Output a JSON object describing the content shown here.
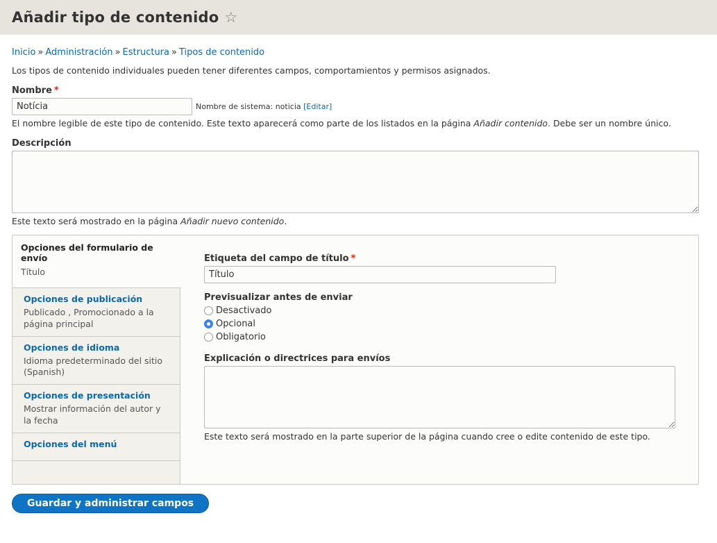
{
  "header": {
    "title": "Añadir tipo de contenido",
    "star": "☆"
  },
  "breadcrumb": {
    "items": [
      "Inicio",
      "Administración",
      "Estructura",
      "Tipos de contenido"
    ],
    "separator": "»"
  },
  "intro": "Los tipos de contenido individuales pueden tener diferentes campos, comportamientos y permisos asignados.",
  "name_field": {
    "label": "Nombre",
    "required_mark": "*",
    "value": "Notícia",
    "machine_prefix": "Nombre de sistema: noticia",
    "machine_edit": "[Editar]",
    "desc_before": "El nombre legible de este tipo de contenido. Este texto aparecerá como parte de los listados en la página ",
    "desc_em": "Añadir contenido",
    "desc_after": ". Debe ser un nombre único."
  },
  "description_field": {
    "label": "Descripción",
    "value": "",
    "desc_before": "Este texto será mostrado en la página ",
    "desc_em": "Añadir nuevo contenido",
    "desc_after": "."
  },
  "tabs": [
    {
      "title": "Opciones del formulario de envío",
      "summary": "Título"
    },
    {
      "title": "Opciones de publicación",
      "summary": "Publicado , Promocionado a la página principal"
    },
    {
      "title": "Opciones de idioma",
      "summary": "Idioma predeterminado del sitio (Spanish)"
    },
    {
      "title": "Opciones de presentación",
      "summary": "Mostrar información del autor y la fecha"
    },
    {
      "title": "Opciones del menú",
      "summary": ""
    }
  ],
  "pane": {
    "title_label": "Etiqueta del campo de título",
    "title_required": "*",
    "title_value": "Título",
    "preview_label": "Previsualizar antes de enviar",
    "preview_options": [
      "Desactivado",
      "Opcional",
      "Obligatorio"
    ],
    "preview_selected": "Opcional",
    "help_label": "Explicación o directrices para envíos",
    "help_value": "",
    "help_desc": "Este texto será mostrado en la parte superior de la página cuando cree o edite contenido de este tipo."
  },
  "submit_label": "Guardar y administrar campos",
  "colors": {
    "link": "#0c68b1",
    "button": "#0f74c4",
    "required": "#e32700",
    "header_bg": "#e6e4dc"
  }
}
